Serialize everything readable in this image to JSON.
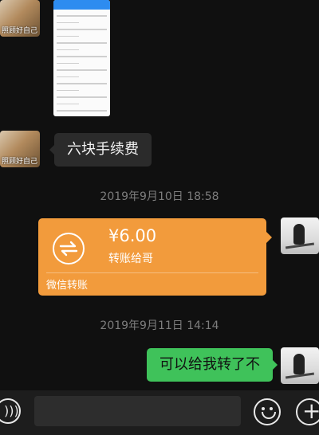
{
  "chat": {
    "contact_avatar_caption": "照顾好自己",
    "messages": {
      "received_text": "六块手续费",
      "sent_text": "可以给我转了不"
    },
    "timestamps": [
      "2019年9月10日 18:58",
      "2019年9月11日 14:14"
    ],
    "transfer": {
      "amount": "¥6.00",
      "note": "转账给哥",
      "footer": "微信转账"
    }
  },
  "colors": {
    "background": "#101010",
    "transfer_orange": "#f29b3c",
    "sent_bubble_green": "#3fc25a",
    "received_bubble": "#2b2b2b"
  },
  "icons": {
    "voice": "voice-icon",
    "emoji": "emoji-icon",
    "plus": "plus-icon",
    "transfer": "transfer-arrows-icon"
  }
}
